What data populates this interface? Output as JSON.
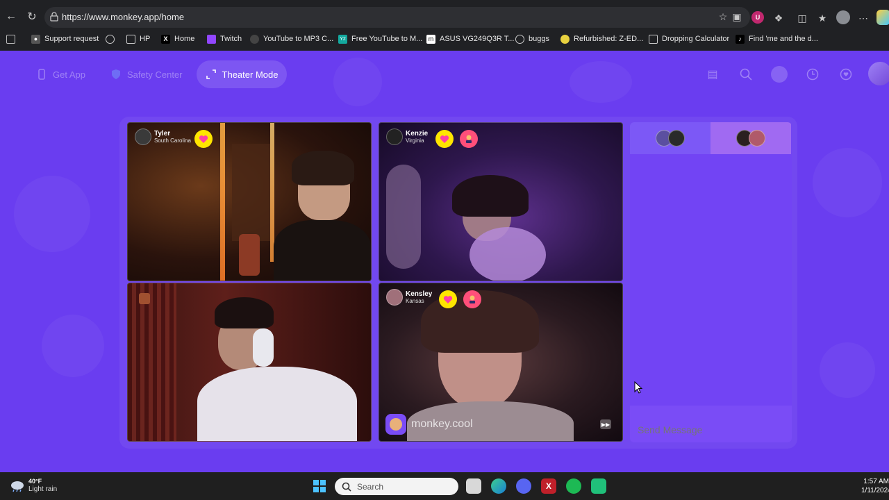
{
  "browser": {
    "url": "https://www.monkey.app/home",
    "profile_initial": "U",
    "bookmarks": [
      {
        "label": "Support request",
        "icon": "support-icon"
      },
      {
        "label": "",
        "icon": "globe-icon"
      },
      {
        "label": "HP",
        "icon": "folder-icon"
      },
      {
        "label": "Home",
        "icon": "x-icon"
      },
      {
        "label": "Twitch",
        "icon": "twitch-icon"
      },
      {
        "label": "YouTube to MP3 C...",
        "icon": "converter-icon"
      },
      {
        "label": "Free YouTube to M...",
        "icon": "ytm-icon"
      },
      {
        "label": "ASUS VG249Q3R T...",
        "icon": "monitor-icon"
      },
      {
        "label": "buggs",
        "icon": "globe-icon"
      },
      {
        "label": "Refurbished: Z-ED...",
        "icon": "lemon-icon"
      },
      {
        "label": "Dropping Calculator",
        "icon": "calculator-icon"
      },
      {
        "label": "Find 'me and the d...",
        "icon": "tiktok-icon"
      }
    ]
  },
  "monkey": {
    "nav": {
      "get_app": "Get App",
      "safety_center": "Safety Center",
      "theater_mode": "Theater Mode"
    },
    "videos": [
      {
        "name": "Tyler",
        "location": "South Carolina"
      },
      {
        "name": "Kenzie",
        "location": "Virginia"
      },
      {
        "name": "",
        "location": ""
      },
      {
        "name": "Kensley",
        "location": "Kansas"
      }
    ],
    "watermark": "monkey.cool",
    "chat": {
      "placeholder": "Send Message"
    },
    "colors": {
      "background": "#6a3df0",
      "heart_badge": "#ffe500",
      "red_badge": "#ff4f7a"
    }
  },
  "taskbar": {
    "temp": "40°F",
    "weather": "Light rain",
    "search_placeholder": "Search",
    "time": "1:57 AM",
    "date": "1/11/2024"
  }
}
